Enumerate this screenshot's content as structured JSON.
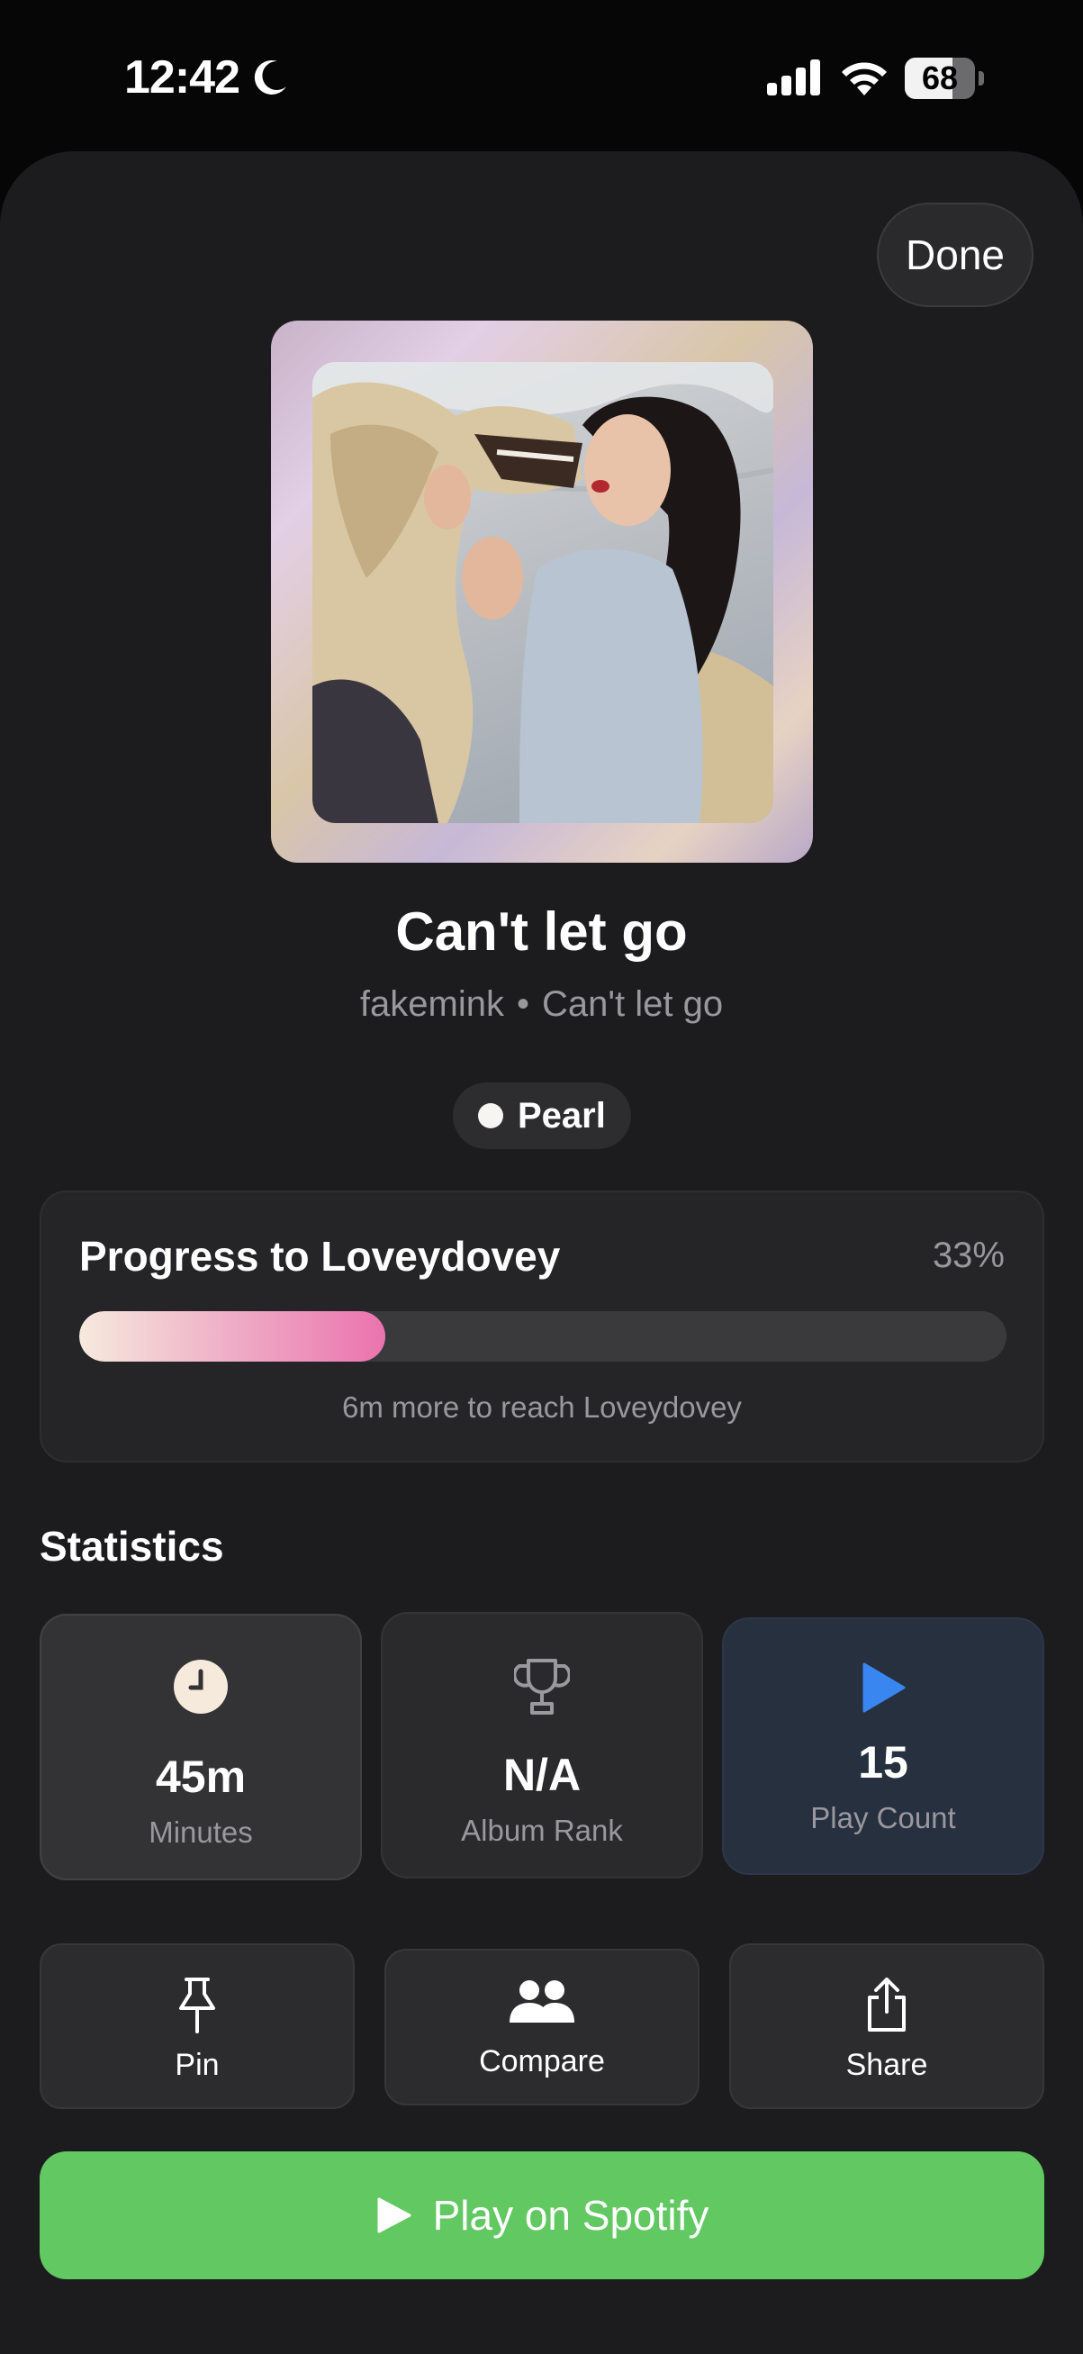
{
  "status_bar": {
    "time": "12:42",
    "battery_level": 68,
    "battery_text": "68"
  },
  "done_label": "Done",
  "song": {
    "title": "Can't let go",
    "artist": "fakemink",
    "separator": "•",
    "album": "Can't let go"
  },
  "tier": {
    "label": "Pearl"
  },
  "progress": {
    "title": "Progress to Loveydovey",
    "percent_text": "33%",
    "fraction": 0.33,
    "note": "6m more to reach Loveydovey"
  },
  "statistics": {
    "title": "Statistics",
    "cards": [
      {
        "icon": "clock-icon",
        "value": "45m",
        "label": "Minutes"
      },
      {
        "icon": "trophy-icon",
        "value": "N/A",
        "label": "Album Rank"
      },
      {
        "icon": "play-icon",
        "value": "15",
        "label": "Play Count"
      }
    ]
  },
  "actions": [
    {
      "icon": "pin-icon",
      "label": "Pin"
    },
    {
      "icon": "people-icon",
      "label": "Compare"
    },
    {
      "icon": "share-icon",
      "label": "Share"
    }
  ],
  "spotify": {
    "label": "Play on Spotify",
    "color": "#62c862"
  },
  "colors": {
    "background": "#1c1c1e",
    "accent_blue": "#3a86f0",
    "progress_pink": "#eb73ae"
  }
}
